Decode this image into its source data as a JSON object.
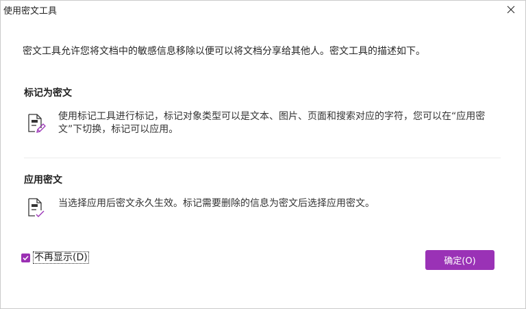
{
  "dialog": {
    "title": "使用密文工具",
    "intro": "密文工具允许您将文档中的敏感信息移除以便可以将文档分享给其他人。密文工具的描述如下。"
  },
  "sections": [
    {
      "title": "标记为密文",
      "description": "使用标记工具进行标记，标记对象类型可以是文本、图片、页面和搜索对应的字符，您可以在“应用密文”下切换，标记可以应用。",
      "icon": "document-pen-icon"
    },
    {
      "title": "应用密文",
      "description": "当选择应用后密文永久生效。标记需要删除的信息为密文后选择应用密文。",
      "icon": "document-check-icon"
    }
  ],
  "footer": {
    "dont_show_label": "不再显示(D)",
    "dont_show_checked": true,
    "ok_label": "确定(O)"
  },
  "colors": {
    "accent": "#9a32b6"
  }
}
